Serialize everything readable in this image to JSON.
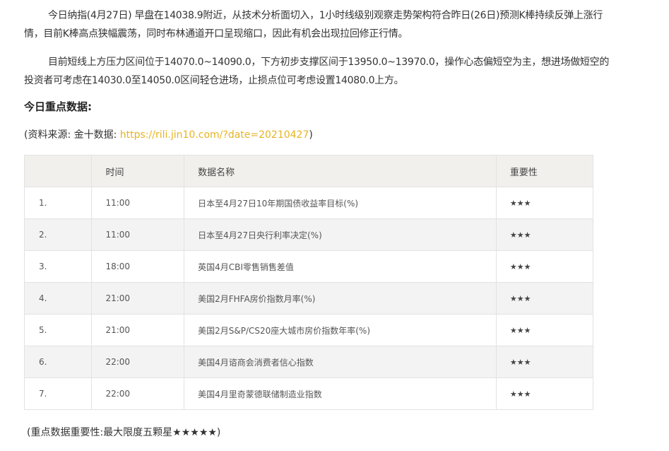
{
  "paragraphs": [
    "今日纳指(4月27日) 早盘在14038.9附近，从技术分析面切入，1小时线级别观察走势架构符合昨日(26日)预测K棒持续反弹上涨行情，目前K棒高点狭幅震荡，同时布林通道开口呈现缩口，因此有机会出现拉回修正行情。",
    "目前短线上方压力区间位于14070.0~14090.0，下方初步支撑区间于13950.0~13970.0，操作心态偏短空为主，想进场做短空的投资者可考虑在14030.0至14050.0区间轻仓进场，止损点位可考虑设置14080.0上方。"
  ],
  "heading": "今日重点数据:",
  "source": {
    "prefix": "(资料来源: 金十数据: ",
    "link": "https://rili.jin10.com/?date=20210427",
    "suffix": ")"
  },
  "table": {
    "headers": [
      "",
      "时间",
      "数据名称",
      "重要性"
    ],
    "rows": [
      {
        "num": "1.",
        "time": "11:00",
        "name": "日本至4月27日10年期国债收益率目标(%)",
        "importance": "★★★"
      },
      {
        "num": "2.",
        "time": "11:00",
        "name": "日本至4月27日央行利率决定(%)",
        "importance": "★★★"
      },
      {
        "num": "3.",
        "time": "18:00",
        "name": "英国4月CBI零售销售差值",
        "importance": "★★★"
      },
      {
        "num": "4.",
        "time": "21:00",
        "name": "美国2月FHFA房价指数月率(%)",
        "importance": "★★★"
      },
      {
        "num": "5.",
        "time": "21:00",
        "name": "美国2月S&P/CS20座大城市房价指数年率(%)",
        "importance": "★★★"
      },
      {
        "num": "6.",
        "time": "22:00",
        "name": "美国4月谘商会消费者信心指数",
        "importance": "★★★"
      },
      {
        "num": "7.",
        "time": "22:00",
        "name": "美国4月里奇蒙德联储制造业指数",
        "importance": "★★★"
      }
    ]
  },
  "footnote": "(重点数据重要性:最大限度五颗星★★★★★)",
  "colors": {
    "link": "#e6b422",
    "header_bg": "#f1f0ed",
    "stripe_bg": "#f3f3f3"
  }
}
